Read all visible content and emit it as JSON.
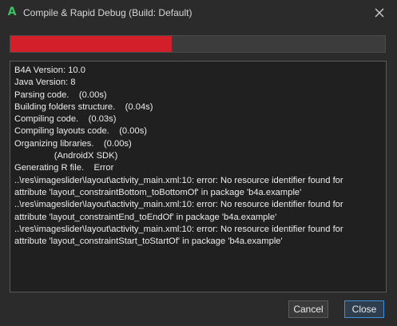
{
  "window": {
    "title": "Compile & Rapid Debug (Build: Default)",
    "app_icon_glyph": "A",
    "app_icon": "b4a-logo-icon",
    "close_icon": "close-icon"
  },
  "progress": {
    "fraction": 0.43,
    "fill_color": "#d21f2a"
  },
  "log": {
    "lines": [
      "B4A Version: 10.0",
      "Java Version: 8",
      "Parsing code.    (0.00s)",
      "Building folders structure.    (0.04s)",
      "Compiling code.    (0.03s)",
      "Compiling layouts code.    (0.00s)",
      "Organizing libraries.    (0.00s)",
      "                (AndroidX SDK)",
      "Generating R file.    Error",
      "..\\res\\imageslider\\layout\\activity_main.xml:10: error: No resource identifier found for",
      "attribute 'layout_constraintBottom_toBottomOf' in package 'b4a.example'",
      "..\\res\\imageslider\\layout\\activity_main.xml:10: error: No resource identifier found for",
      "attribute 'layout_constraintEnd_toEndOf' in package 'b4a.example'",
      "..\\res\\imageslider\\layout\\activity_main.xml:10: error: No resource identifier found for",
      "attribute 'layout_constraintStart_toStartOf' in package 'b4a.example'"
    ]
  },
  "buttons": {
    "cancel_label": "Cancel",
    "close_label": "Close"
  }
}
